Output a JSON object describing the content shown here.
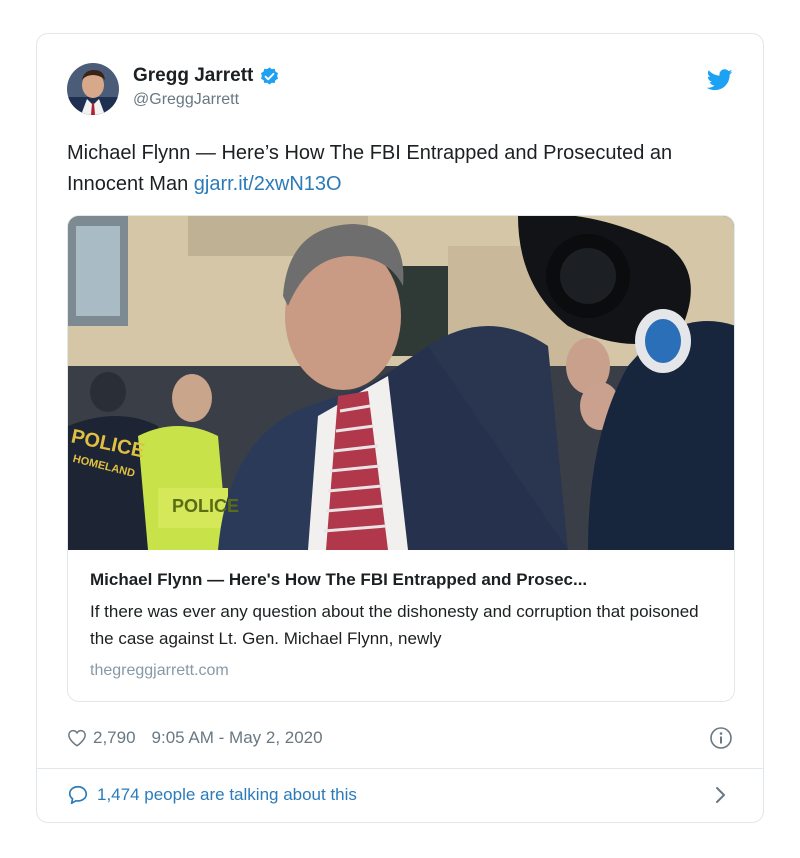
{
  "tweet": {
    "display_name": "Gregg Jarrett",
    "handle": "@GreggJarrett",
    "text_main": "Michael Flynn — Here’s How The FBI Entrapped and Prosecuted an Innocent Man ",
    "link": "gjarr.it/2xwN13O",
    "verified": true
  },
  "card": {
    "title": "Michael Flynn — Here's How The FBI Entrapped and Prosec...",
    "description": "If there was ever any question about the dishonesty and corruption that poisoned the case against Lt. Gen. Michael Flynn, newly",
    "domain": "thegreggjarrett.com",
    "image_text": {
      "vest_label": "POLICE",
      "jacket_label": "POLICE",
      "jacket_sublabel": "HOMELAND"
    }
  },
  "meta": {
    "likes": "2,790",
    "timestamp": "9:05 AM - May 2, 2020"
  },
  "footer": {
    "talking": "1,474 people are talking about this"
  },
  "icons": {
    "verified": "verified-badge-icon",
    "bird": "twitter-bird-icon",
    "heart": "heart-icon",
    "info": "info-icon",
    "bubble": "speech-bubble-icon",
    "chevron": "chevron-right-icon"
  },
  "colors": {
    "link": "#2b7bb9",
    "twitter_blue": "#1da1f2",
    "muted": "#697882",
    "border": "#e1e8ed"
  }
}
